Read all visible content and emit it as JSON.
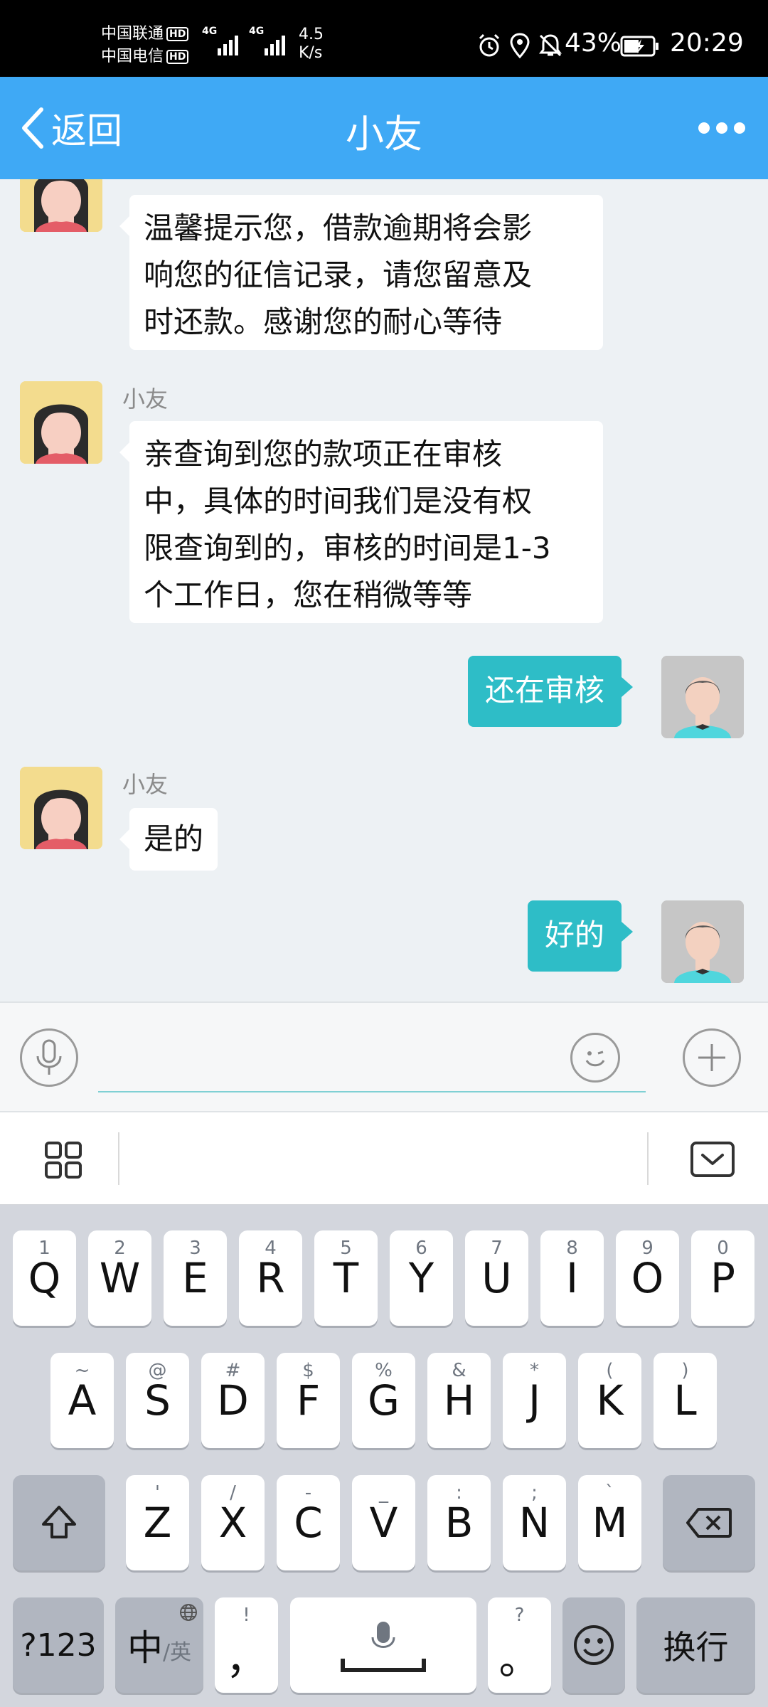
{
  "status_bar": {
    "carrier1": "中国联通",
    "carrier2": "中国电信",
    "hd": "HD",
    "net1": "4G",
    "net2": "4G",
    "speed_value": "4.5",
    "speed_unit": "K/s",
    "battery": "43%",
    "time": "20:29"
  },
  "header": {
    "back_label": "返回",
    "title": "小友"
  },
  "chat": {
    "messages": [
      {
        "text_lines": [
          "温馨提示您，借款逾期将会影",
          "响您的征信记录，请您留意及",
          "时还款。感谢您的耐心等待"
        ]
      },
      {
        "sender": "小友",
        "text_lines": [
          "亲查询到您的款项正在审核",
          "中，具体的时间我们是没有权",
          "限查询到的，审核的时间是1-3",
          "个工作日，您在稍微等等"
        ]
      },
      {
        "text": "还在审核"
      },
      {
        "sender": "小友",
        "text": "是的"
      },
      {
        "text": "好的"
      }
    ]
  },
  "input": {
    "placeholder": "",
    "value": ""
  },
  "keyboard": {
    "row1": [
      {
        "main": "Q",
        "sub": "1"
      },
      {
        "main": "W",
        "sub": "2"
      },
      {
        "main": "E",
        "sub": "3"
      },
      {
        "main": "R",
        "sub": "4"
      },
      {
        "main": "T",
        "sub": "5"
      },
      {
        "main": "Y",
        "sub": "6"
      },
      {
        "main": "U",
        "sub": "7"
      },
      {
        "main": "I",
        "sub": "8"
      },
      {
        "main": "O",
        "sub": "9"
      },
      {
        "main": "P",
        "sub": "0"
      }
    ],
    "row2": [
      {
        "main": "A",
        "sub": "~"
      },
      {
        "main": "S",
        "sub": "@"
      },
      {
        "main": "D",
        "sub": "#"
      },
      {
        "main": "F",
        "sub": "$"
      },
      {
        "main": "G",
        "sub": "%"
      },
      {
        "main": "H",
        "sub": "&"
      },
      {
        "main": "J",
        "sub": "*"
      },
      {
        "main": "K",
        "sub": "("
      },
      {
        "main": "L",
        "sub": ")"
      }
    ],
    "row3": [
      {
        "main": "Z",
        "sub": "'"
      },
      {
        "main": "X",
        "sub": "/"
      },
      {
        "main": "C",
        "sub": "-"
      },
      {
        "main": "V",
        "sub": "_"
      },
      {
        "main": "B",
        "sub": ":"
      },
      {
        "main": "N",
        "sub": ";"
      },
      {
        "main": "M",
        "sub": "`"
      }
    ],
    "sym_label": "?123",
    "lang_main": "中",
    "lang_sub": "/英",
    "comma_main": "，",
    "comma_sub": "!",
    "period_main": "。",
    "period_sub": "?",
    "enter_label": "换行"
  },
  "colors": {
    "header_bg": "#3fa9f5",
    "outgoing_bubble": "#2ebdc7",
    "chat_bg": "#edf1f4",
    "keyboard_bg": "#d3d6dd"
  }
}
